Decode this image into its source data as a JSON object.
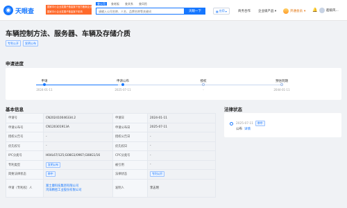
{
  "header": {
    "logo_text": "天眼查",
    "slogan_line1": "国家中小企业发展子基金旗下官方备案企业征信机构",
    "slogan_line2": "国家中小企业发展子基金旗下机构",
    "search_tabs": [
      "查公司",
      "查老板",
      "查关系",
      "查风险"
    ],
    "search_placeholder": "请输入公司名称、人名、品牌名称等关键词",
    "search_button": "天眼一下",
    "app_label": "应用",
    "nav": [
      "商务合作",
      "企业级产品"
    ],
    "vip_label": "开通会员",
    "user_name": "超级风..."
  },
  "page": {
    "title": "车辆控制方法、服务器、车辆及存储介质",
    "tags": [
      "专利公开",
      "发明公布"
    ]
  },
  "progress": {
    "section_title": "申请进度",
    "steps": [
      {
        "label": "申请",
        "date": "2024-01-11",
        "done": true
      },
      {
        "label": "申请公布",
        "date": "2025-07-11",
        "done": true
      },
      {
        "label": "授权",
        "date": "-",
        "done": false
      },
      {
        "label": "预估到期",
        "date": "2044-01-11",
        "done": false
      }
    ]
  },
  "basic": {
    "section_title": "基本信息",
    "rows": [
      {
        "k1": "申请号",
        "v1": "CN202410046334.2",
        "k2": "申请日",
        "v2": "2024-01-11"
      },
      {
        "k1": "申请公布号",
        "v1": "CN120301913A",
        "k2": "申请公布日",
        "v2": "2025-07-11"
      },
      {
        "k1": "授权公告号",
        "v1": "-",
        "k2": "授权公告日",
        "v2": "-"
      },
      {
        "k1": "优先权号",
        "v1": "-",
        "k2": "优先权日",
        "v2": "-"
      },
      {
        "k1": "IPC分类号",
        "v1": "H04L67/125;G08G1/0967;G08G1/16",
        "k2": "CPC分类号",
        "v2": "-"
      },
      {
        "k1": "专利类型",
        "v1": "发明公布",
        "k2": "被引用",
        "v2": "-"
      },
      {
        "k1": "简要法律状态",
        "v1": "审中",
        "k2": "法律状态",
        "v2": "专利公开"
      }
    ],
    "applicant_label": "申请（专利权）人",
    "applicants": [
      "富士康科技集团有限公司",
      "鸿海精密工业股份有限公司"
    ],
    "inventor_label": "发明人",
    "inventor": "李志明"
  },
  "legal": {
    "section_title": "法律状态",
    "date": "2025-07-11",
    "status_tag": "审中",
    "event": "公布",
    "detail_link": "详情"
  },
  "colors": {
    "accent": "#1677ff",
    "slogan_bg": "#ff6a2b",
    "vip": "#e06c00"
  }
}
